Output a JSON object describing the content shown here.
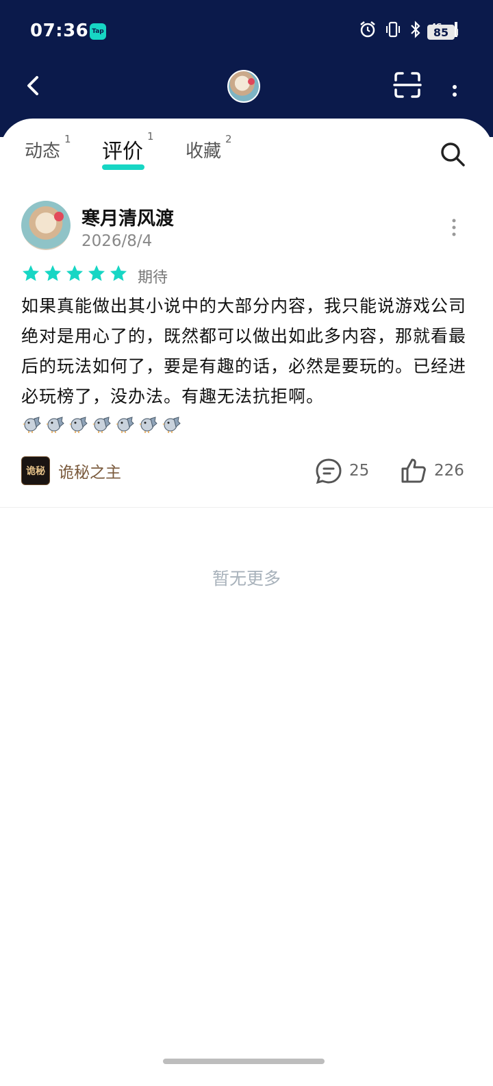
{
  "status_bar": {
    "time": "07:36",
    "app_badge": "Tap",
    "battery": "85",
    "icons": [
      "alarm-icon",
      "vibrate-icon",
      "bluetooth-icon",
      "signal-4g-icon"
    ]
  },
  "header": {
    "bg_color": "#0b1a4b"
  },
  "tabs": [
    {
      "label": "动态",
      "count": "1"
    },
    {
      "label": "评价",
      "count": "1"
    },
    {
      "label": "收藏",
      "count": "2"
    }
  ],
  "active_tab": "评价",
  "review": {
    "username": "寒月清风渡",
    "date": "2026/8/4",
    "rating": 5,
    "rating_max": 5,
    "rating_label": "期待",
    "text": "如果真能做出其小说中的大部分内容，我只能说游戏公司绝对是用心了的，既然都可以做出如此多内容，那就看最后的玩法如何了，要是有趣的话，必然是要玩的。已经进必玩榜了，没办法。有趣无法抗拒啊。",
    "emoji_count": 7,
    "game_icon_text": "诡秘",
    "game_name": "诡秘之主",
    "comment_count": "25",
    "like_count": "226"
  },
  "footer": {
    "no_more": "暂无更多"
  },
  "colors": {
    "accent": "#17d6c4",
    "star": "#17d6c4"
  }
}
